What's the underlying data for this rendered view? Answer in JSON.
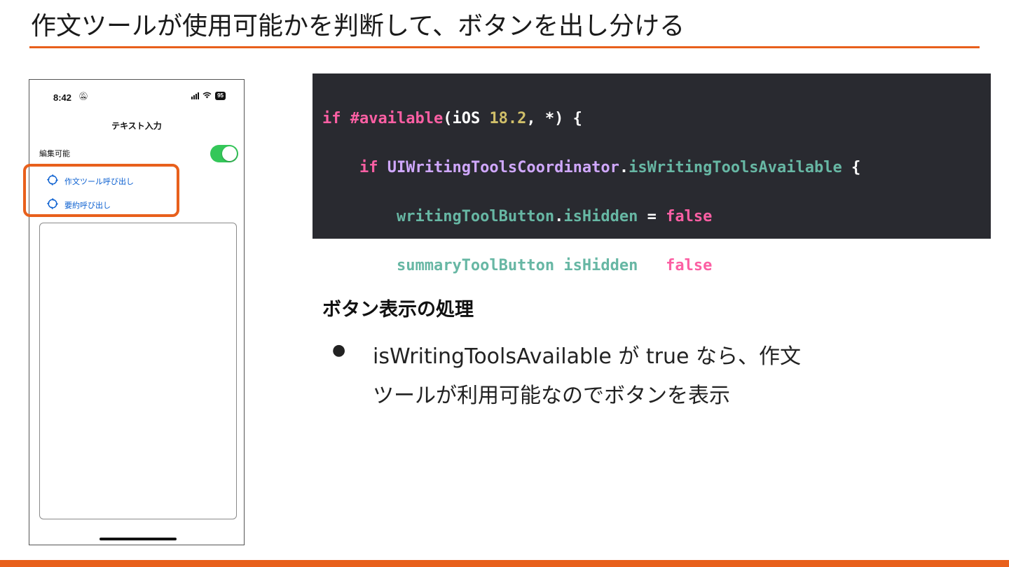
{
  "slide": {
    "title": "作文ツールが使用可能かを判断して、ボタンを出し分ける",
    "accent_color": "#e8601c"
  },
  "phone": {
    "status_time": "8:42",
    "status_bell_icon": "bell-slash-icon",
    "battery_level": "95",
    "nav_title": "テキスト入力",
    "edit_label": "編集可能",
    "toggle_on": true,
    "buttons": [
      {
        "label": "作文ツール呼び出し",
        "icon": "writing-tools-icon"
      },
      {
        "label": "要約呼び出し",
        "icon": "writing-tools-icon"
      }
    ],
    "text_area_value": ""
  },
  "code": {
    "lines": [
      "if #available(iOS 18.2, *) {",
      "    if UIWritingToolsCoordinator.isWritingToolsAvailable {",
      "        writingToolButton.isHidden = false",
      "        summaryToolButton.isHidden = false",
      "    }",
      "}"
    ],
    "background_color": "#292a30"
  },
  "explanation": {
    "heading": "ボタン表示の処理",
    "bullet": "●",
    "bullet_line1": "isWritingToolsAvailable が true なら、作文",
    "bullet_line2": "ツールが利用可能なのでボタンを表示"
  }
}
